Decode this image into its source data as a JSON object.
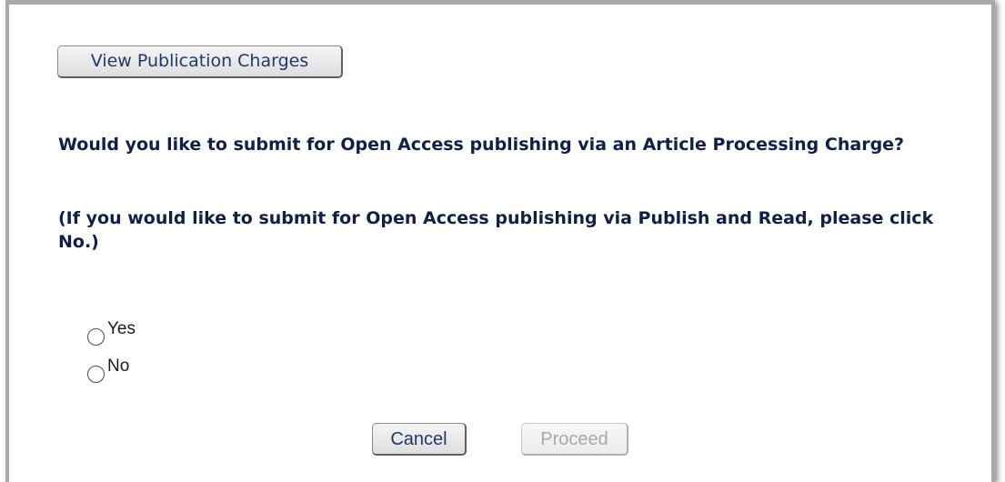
{
  "buttons": {
    "view_charges": "View Publication Charges",
    "cancel": "Cancel",
    "proceed": "Proceed"
  },
  "question": {
    "main": "Would you like to submit for Open Access publishing via an Article Processing Charge?",
    "note": "(If you would like to submit for Open Access publishing via Publish and Read, please click No.)"
  },
  "options": {
    "yes": "Yes",
    "no": "No",
    "selected": ""
  },
  "state": {
    "proceed_enabled": false
  },
  "colors": {
    "question_text": "#0f1f4a",
    "button_text": "#1f3a6a",
    "disabled_text": "#a8a8a8",
    "frame_border": "#a9a9a9"
  }
}
